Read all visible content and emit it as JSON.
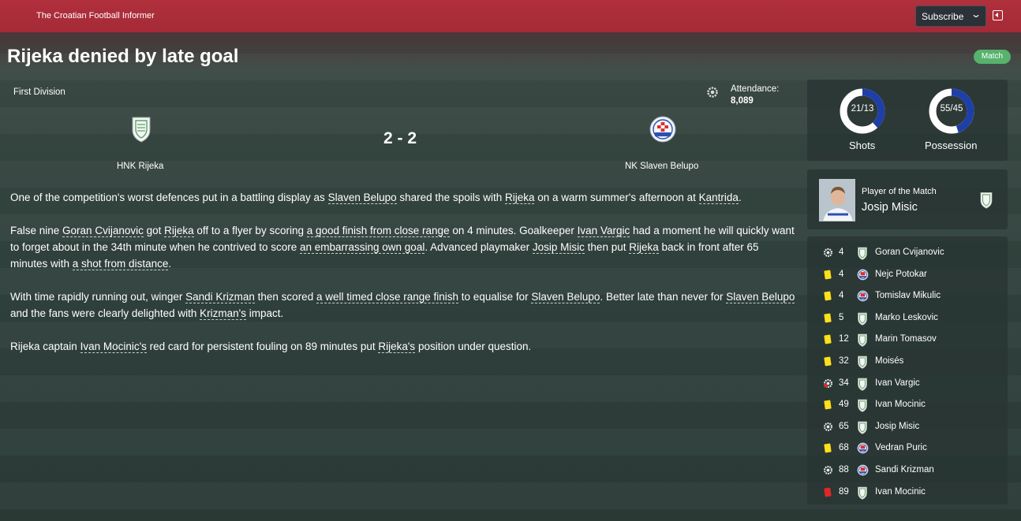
{
  "header": {
    "publication": "The Croatian Football Informer",
    "subscribe_label": "Subscribe"
  },
  "headline": "Rijeka denied by late goal",
  "badge": "Match",
  "match": {
    "competition": "First Division",
    "attendance_label": "Attendance:",
    "attendance": "8,089",
    "score": "2 - 2",
    "home_team": "HNK Rijeka",
    "away_team": "NK Slaven Belupo"
  },
  "stats": {
    "shots": {
      "label": "Shots",
      "value": "21/13",
      "home": 21,
      "away": 13
    },
    "possession": {
      "label": "Possession",
      "value": "55/45",
      "home": 55,
      "away": 45
    }
  },
  "player_of_match": {
    "label": "Player of the Match",
    "name": "Josip Misic"
  },
  "colors": {
    "topbar": "#a52a37",
    "badge": "#56b26d",
    "donut_home": "#1f3fa8",
    "donut_away": "#ffffff",
    "yellow_card": "#ffe01a",
    "red_card": "#e22727"
  },
  "events": [
    {
      "type": "goal-icon",
      "minute": "4",
      "team": "home",
      "player": "Goran Cvijanovic"
    },
    {
      "type": "yellow-card-icon",
      "minute": "4",
      "team": "away",
      "player": "Nejc Potokar"
    },
    {
      "type": "yellow-card-icon",
      "minute": "4",
      "team": "away",
      "player": "Tomislav Mikulic"
    },
    {
      "type": "yellow-card-icon",
      "minute": "5",
      "team": "home",
      "player": "Marko Leskovic"
    },
    {
      "type": "yellow-card-icon",
      "minute": "12",
      "team": "home",
      "player": "Marin Tomasov"
    },
    {
      "type": "yellow-card-icon",
      "minute": "32",
      "team": "home",
      "player": "Moisés"
    },
    {
      "type": "own-goal-icon",
      "minute": "34",
      "team": "home",
      "player": "Ivan Vargic"
    },
    {
      "type": "yellow-card-icon",
      "minute": "49",
      "team": "home",
      "player": "Ivan Mocinic"
    },
    {
      "type": "goal-icon",
      "minute": "65",
      "team": "home",
      "player": "Josip Misic"
    },
    {
      "type": "yellow-card-icon",
      "minute": "68",
      "team": "away",
      "player": "Vedran Puric"
    },
    {
      "type": "goal-icon",
      "minute": "88",
      "team": "away",
      "player": "Sandi Krizman"
    },
    {
      "type": "red-card-icon",
      "minute": "89",
      "team": "home",
      "player": "Ivan Mocinic"
    }
  ],
  "article": {
    "p1": {
      "s1": "One of the competition's worst defences put in a battling display as ",
      "l1": "Slaven Belupo",
      "s2": " shared the spoils with ",
      "l2": "Rijeka",
      "s3": " on a warm summer's afternoon at ",
      "l3": "Kantrida",
      "s4": "."
    },
    "p2": {
      "s1": "False nine ",
      "l1": "Goran Cvijanovic",
      "s2": " got ",
      "l2": "Rijeka",
      "s3": " off to a flyer by scoring ",
      "l3": "a good finish from close range",
      "s4": " on 4 minutes. Goalkeeper ",
      "l4": "Ivan Vargic",
      "s5": " had a moment he will quickly want to forget about in the 34th minute when he contrived to score ",
      "l5": "an embarrassing own goal",
      "s6": ". Advanced playmaker ",
      "l6": "Josip Misic",
      "s7": " then put ",
      "l7": "Rijeka",
      "s8": " back in front after 65 minutes with ",
      "l8": "a shot from distance",
      "s9": "."
    },
    "p3": {
      "s1": "With time rapidly running out, winger ",
      "l1": "Sandi Krizman",
      "s2": " then scored ",
      "l2": "a well timed close range finish",
      "s3": " to equalise for ",
      "l3": "Slaven Belupo",
      "s4": ". Better late than never for ",
      "l4": "Slaven Belupo",
      "s5": " and the fans were clearly delighted with ",
      "l5": "Krizman's",
      "s6": " impact."
    },
    "p4": {
      "s1": "Rijeka captain ",
      "l1": "Ivan Mocinic's",
      "s2": " red card for persistent fouling on 89 minutes put ",
      "l2": "Rijeka's",
      "s3": " position under question."
    }
  }
}
